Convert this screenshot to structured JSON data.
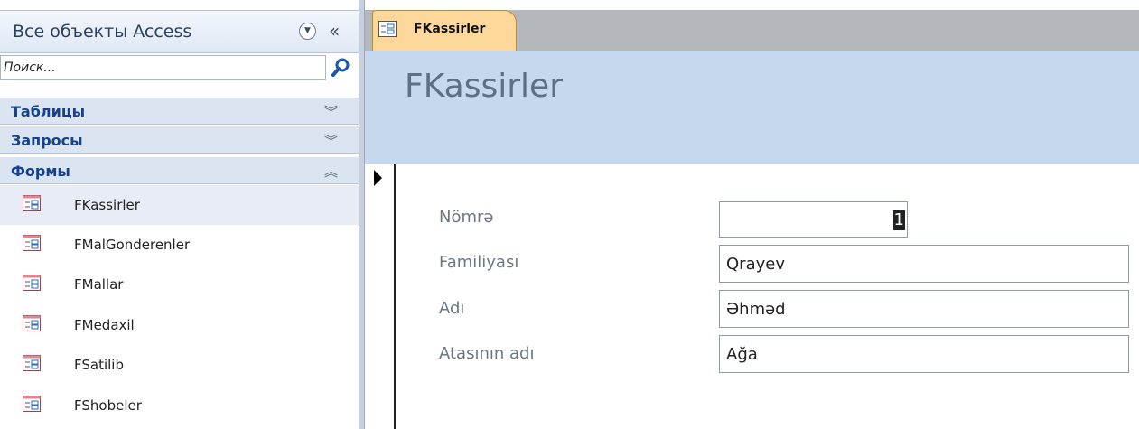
{
  "nav": {
    "title": "Все объекты Access",
    "dropdown_icon": "chevron-circle-down-icon",
    "collapse_glyph": "«",
    "search_placeholder": "Поиск...",
    "groups": [
      {
        "label": "Таблицы",
        "chevron": "¡"
      },
      {
        "label": "Запросы",
        "chevron": "¡"
      },
      {
        "label": "Формы",
        "chevron": "¡"
      }
    ],
    "forms": [
      {
        "label": "FKassirler",
        "selected": true
      },
      {
        "label": "FMalGonderenler"
      },
      {
        "label": "FMallar"
      },
      {
        "label": "FMedaxil"
      },
      {
        "label": "FSatilib"
      },
      {
        "label": "FShobeler"
      }
    ]
  },
  "tab": {
    "label": "FKassirler"
  },
  "form": {
    "title": "FKassirler",
    "fields": [
      {
        "label": "Nömrə",
        "value": "1"
      },
      {
        "label": "Familiyası",
        "value": "Qrayev"
      },
      {
        "label": "Adı",
        "value": "Əhməd"
      },
      {
        "label": "Atasının adı",
        "value": "Ağa"
      }
    ]
  },
  "colors": {
    "tab_active": "#fdd89a",
    "form_header": "#c6d8ee",
    "group_header": "#dbe5f1"
  }
}
